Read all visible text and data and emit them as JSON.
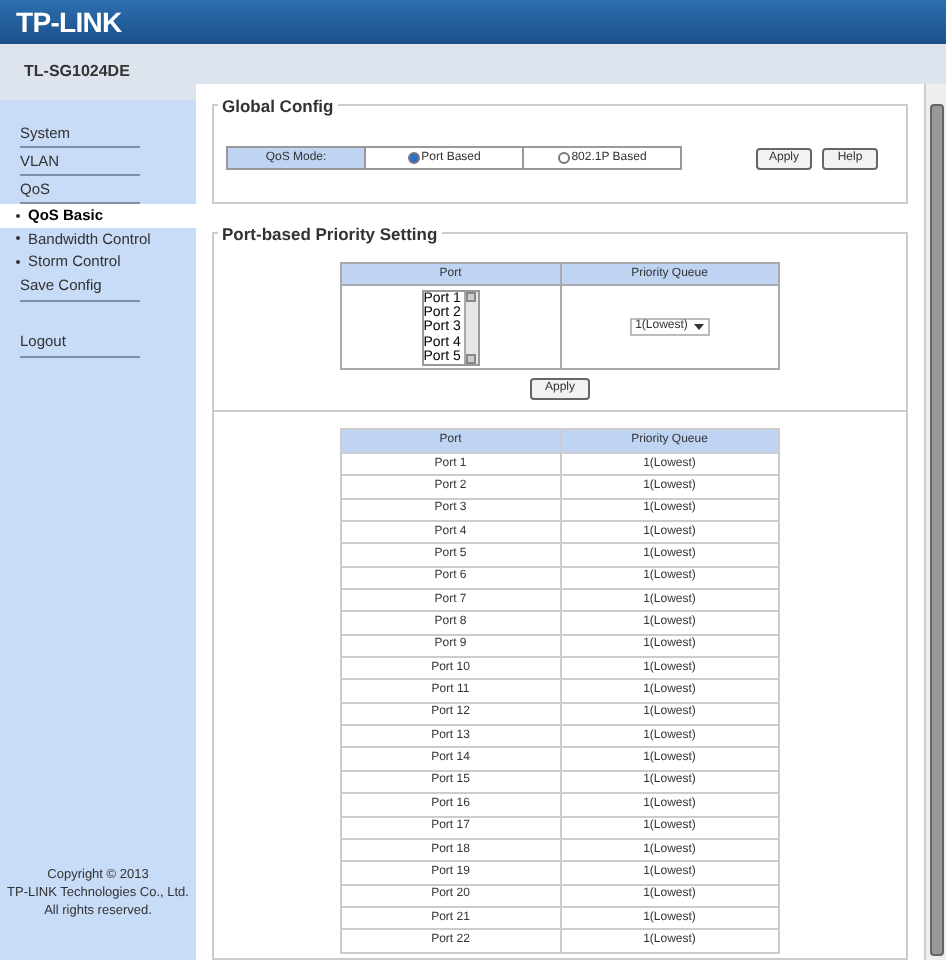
{
  "header": {
    "logo": "TP-LINK"
  },
  "model": "TL-SG1024DE",
  "sidebar": {
    "items": [
      {
        "label": "System",
        "selected": false
      },
      {
        "label": "VLAN",
        "selected": false
      },
      {
        "label": "QoS",
        "selected": false,
        "children": [
          {
            "label": "QoS Basic",
            "selected": true
          },
          {
            "label": "Bandwidth Control",
            "selected": false
          },
          {
            "label": "Storm Control",
            "selected": false
          }
        ]
      },
      {
        "label": "Save Config",
        "selected": false
      },
      {
        "label": "Logout",
        "selected": false
      }
    ],
    "copyright": [
      "Copyright © 2013",
      "TP-LINK Technologies Co., Ltd.",
      "All rights reserved."
    ]
  },
  "global_config": {
    "title": "Global Config",
    "label": "QoS Mode:",
    "options": [
      {
        "label": "Port Based",
        "selected": true
      },
      {
        "label": "802.1P Based",
        "selected": false
      }
    ],
    "buttons": [
      "Apply",
      "Help"
    ]
  },
  "port_setting": {
    "title": "Port-based Priority Setting",
    "columns": [
      "Port",
      "Priority Queue"
    ],
    "port_list": [
      "Port 1",
      "Port 2",
      "Port 3",
      "Port 4",
      "Port 5"
    ],
    "queue_value": "1(Lowest)",
    "button": "Apply"
  },
  "table": {
    "columns": [
      "Port",
      "Priority Queue"
    ],
    "rows": [
      [
        "Port 1",
        "1(Lowest)"
      ],
      [
        "Port 2",
        "1(Lowest)"
      ],
      [
        "Port 3",
        "1(Lowest)"
      ],
      [
        "Port 4",
        "1(Lowest)"
      ],
      [
        "Port 5",
        "1(Lowest)"
      ],
      [
        "Port 6",
        "1(Lowest)"
      ],
      [
        "Port 7",
        "1(Lowest)"
      ],
      [
        "Port 8",
        "1(Lowest)"
      ],
      [
        "Port 9",
        "1(Lowest)"
      ],
      [
        "Port 10",
        "1(Lowest)"
      ],
      [
        "Port 11",
        "1(Lowest)"
      ],
      [
        "Port 12",
        "1(Lowest)"
      ],
      [
        "Port 13",
        "1(Lowest)"
      ],
      [
        "Port 14",
        "1(Lowest)"
      ],
      [
        "Port 15",
        "1(Lowest)"
      ],
      [
        "Port 16",
        "1(Lowest)"
      ],
      [
        "Port 17",
        "1(Lowest)"
      ],
      [
        "Port 18",
        "1(Lowest)"
      ],
      [
        "Port 19",
        "1(Lowest)"
      ],
      [
        "Port 20",
        "1(Lowest)"
      ],
      [
        "Port 21",
        "1(Lowest)"
      ],
      [
        "Port 22",
        "1(Lowest)"
      ]
    ]
  }
}
